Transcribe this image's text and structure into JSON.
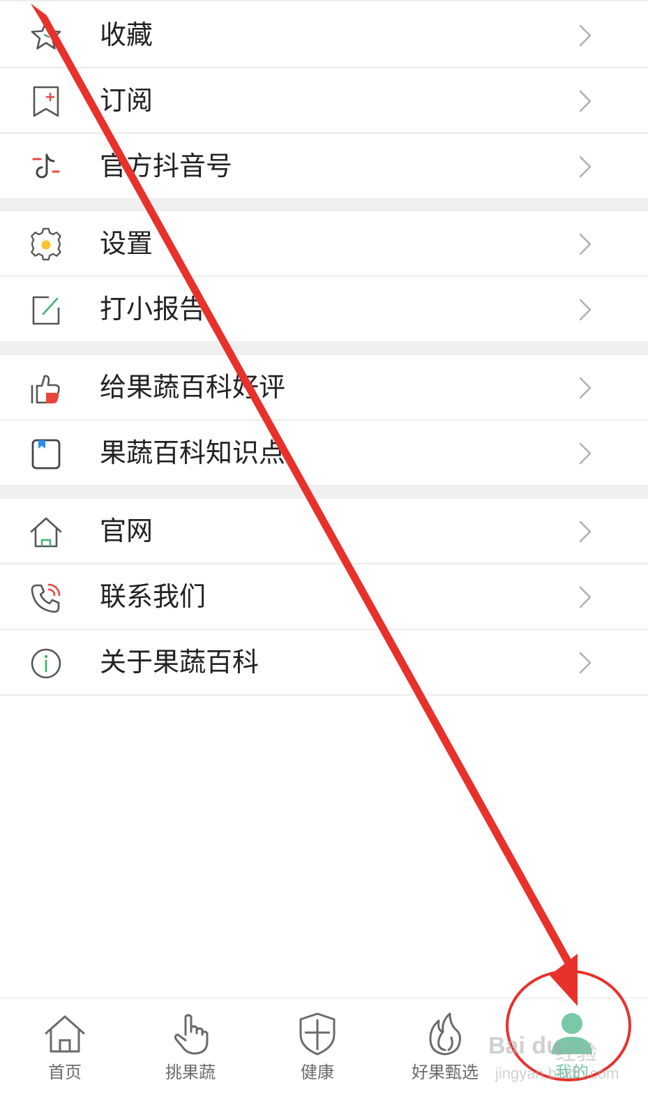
{
  "menu": {
    "items": [
      {
        "label": "收藏",
        "icon": "star-icon"
      },
      {
        "label": "订阅",
        "icon": "bookmark-add-icon"
      },
      {
        "label": "官方抖音号",
        "icon": "tiktok-icon"
      },
      {
        "label": "设置",
        "icon": "gear-icon"
      },
      {
        "label": "打小报告",
        "icon": "edit-note-icon"
      },
      {
        "label": "给果蔬百科好评",
        "icon": "thumbs-up-icon"
      },
      {
        "label": "果蔬百科知识点",
        "icon": "knowledge-book-icon"
      },
      {
        "label": "官网",
        "icon": "home-outline-icon"
      },
      {
        "label": "联系我们",
        "icon": "phone-icon"
      },
      {
        "label": "关于果蔬百科",
        "icon": "info-icon"
      }
    ]
  },
  "tabbar": {
    "tabs": [
      {
        "label": "首页",
        "icon": "home-icon",
        "active": false
      },
      {
        "label": "挑果蔬",
        "icon": "hand-pointer-icon",
        "active": false
      },
      {
        "label": "健康",
        "icon": "shield-icon",
        "active": false
      },
      {
        "label": "好果甄选",
        "icon": "flame-icon",
        "active": false
      },
      {
        "label": "我的",
        "icon": "user-icon",
        "active": true
      }
    ]
  },
  "watermark": {
    "brand": "Bai du",
    "sub": "经验",
    "url": "jingyan.baidu.com"
  },
  "colors": {
    "accent": "#79c9a7",
    "annotation_red": "#e8312b",
    "icon_gray": "#666666",
    "icon_red": "#e8453c",
    "icon_blue": "#2d8cf0",
    "icon_yellow": "#f7c531"
  }
}
